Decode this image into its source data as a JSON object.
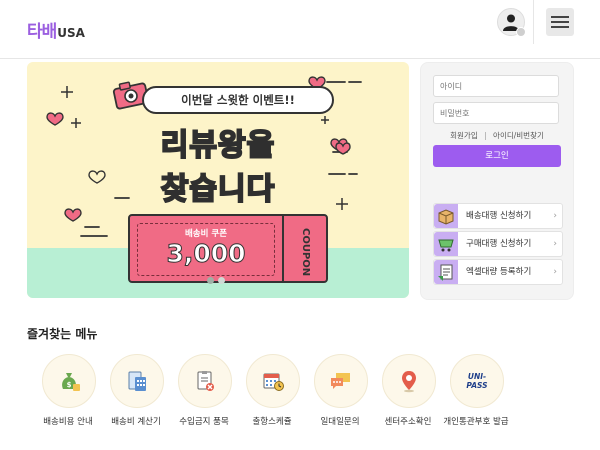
{
  "header": {
    "logo_ko": "타배",
    "logo_en": "USA"
  },
  "banner": {
    "tag": "이번달 스윗한 이벤트!!",
    "headline_line1": "리뷰왕을",
    "headline_line2": "찾습니다",
    "coupon_label": "배송비 쿠폰",
    "coupon_amount": "3,000",
    "coupon_side": "COUPON",
    "slide_count": 2,
    "active_slide": 1
  },
  "login": {
    "id_placeholder": "아이디",
    "pw_placeholder": "비밀번호",
    "signup_link": "회원가입",
    "separator": "|",
    "find_link": "아이디/비번찾기",
    "login_button": "로그인"
  },
  "services": [
    {
      "label": "배송대행 신청하기",
      "icon": "box-icon"
    },
    {
      "label": "구매대행 신청하기",
      "icon": "cart-icon"
    },
    {
      "label": "엑셀대량 등록하기",
      "icon": "excel-list-icon"
    }
  ],
  "favorites": {
    "title": "즐겨찾는 메뉴",
    "items": [
      {
        "label": "배송비용 안내",
        "icon": "money-bag-icon"
      },
      {
        "label": "배송비 계산기",
        "icon": "calculator-icon"
      },
      {
        "label": "수입금지 품목",
        "icon": "prohibited-list-icon"
      },
      {
        "label": "출항스케쥴",
        "icon": "calendar-icon"
      },
      {
        "label": "일대일문의",
        "icon": "chat-icon"
      },
      {
        "label": "센터주소확인",
        "icon": "location-pin-icon"
      },
      {
        "label": "개인통관부호 발급",
        "icon": "unipass-icon",
        "icon_text": "UNI-PASS"
      }
    ]
  },
  "colors": {
    "brand_purple": "#9d5cef",
    "banner_yellow": "#fdf4c9",
    "banner_mint": "#b8efd4",
    "coupon_pink": "#f06b85"
  }
}
